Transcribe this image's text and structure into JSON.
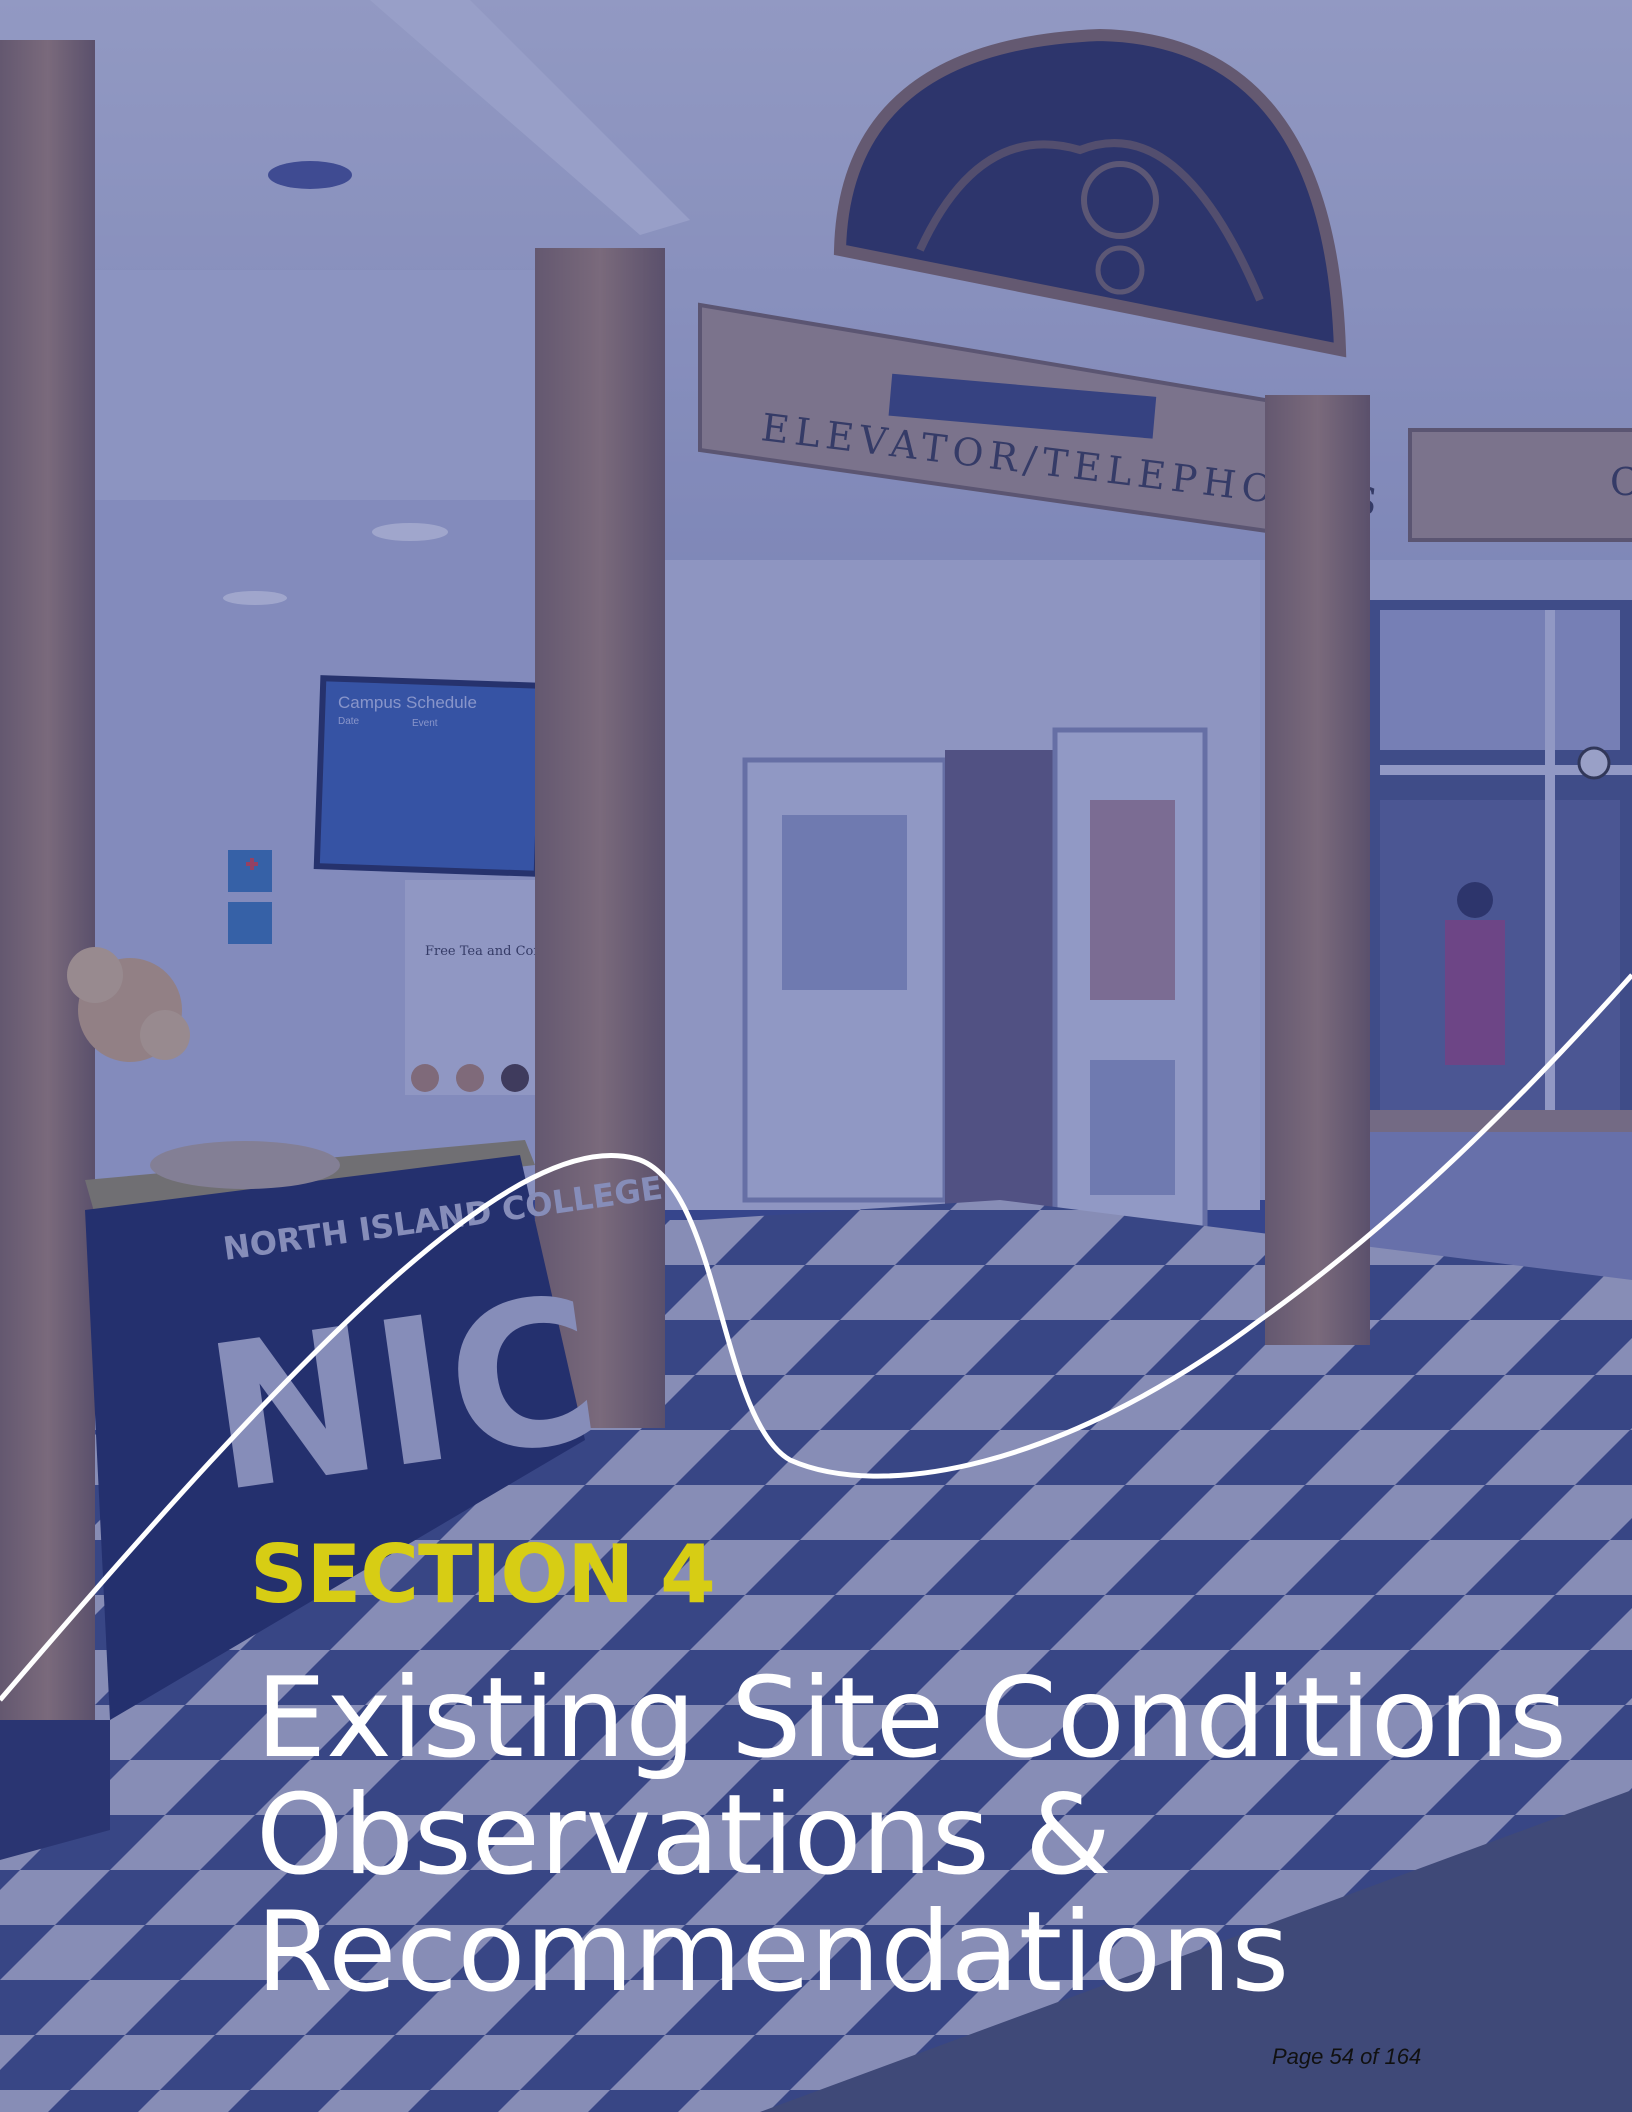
{
  "cover": {
    "section_label": "SECTION 4",
    "title_lines": [
      "Existing Site Conditions",
      "Observations &",
      "Recommendations"
    ],
    "page_number": "Page 54 of 164"
  },
  "photo": {
    "sign_elevator": "ELEVATOR/TELEPHONES",
    "sign_partial": "C",
    "screen_title": "Campus Schedule",
    "screen_col_date": "Date",
    "screen_col_event": "Event",
    "poster_title": "Free Tea and Coffee",
    "table_brand": "NORTH ISLAND COLLEGE",
    "table_logo": "NIC"
  },
  "colors": {
    "overlay_blue": "#2f3f8f",
    "section_yellow": "#d7cd14",
    "title_white": "#ffffff"
  }
}
